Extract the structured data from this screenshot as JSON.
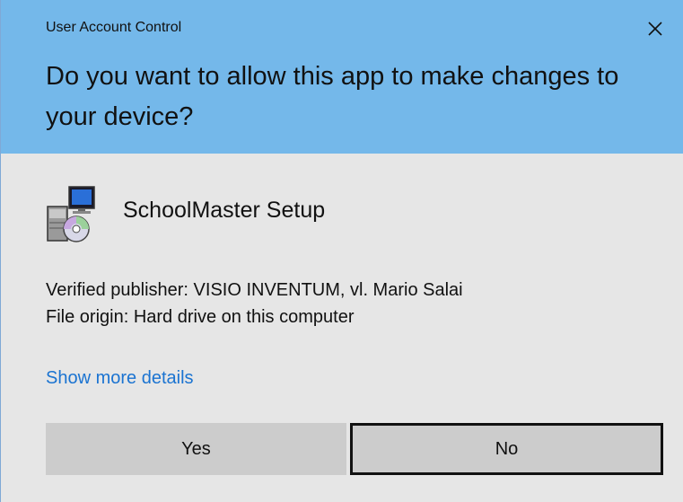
{
  "window": {
    "title": "User Account Control"
  },
  "prompt": {
    "headline": "Do you want to allow this app to make changes to your device?"
  },
  "app": {
    "name": "SchoolMaster Setup",
    "icon": "installer-icon"
  },
  "info": {
    "publisher": "Verified publisher: VISIO INVENTUM, vl. Mario Salai",
    "origin": "File origin: Hard drive on this computer"
  },
  "links": {
    "details": "Show more details"
  },
  "buttons": {
    "yes": "Yes",
    "no": "No"
  },
  "colors": {
    "header": "#74b8ea",
    "body": "#e6e6e6",
    "link": "#1a73d1",
    "button": "#cccccc"
  }
}
